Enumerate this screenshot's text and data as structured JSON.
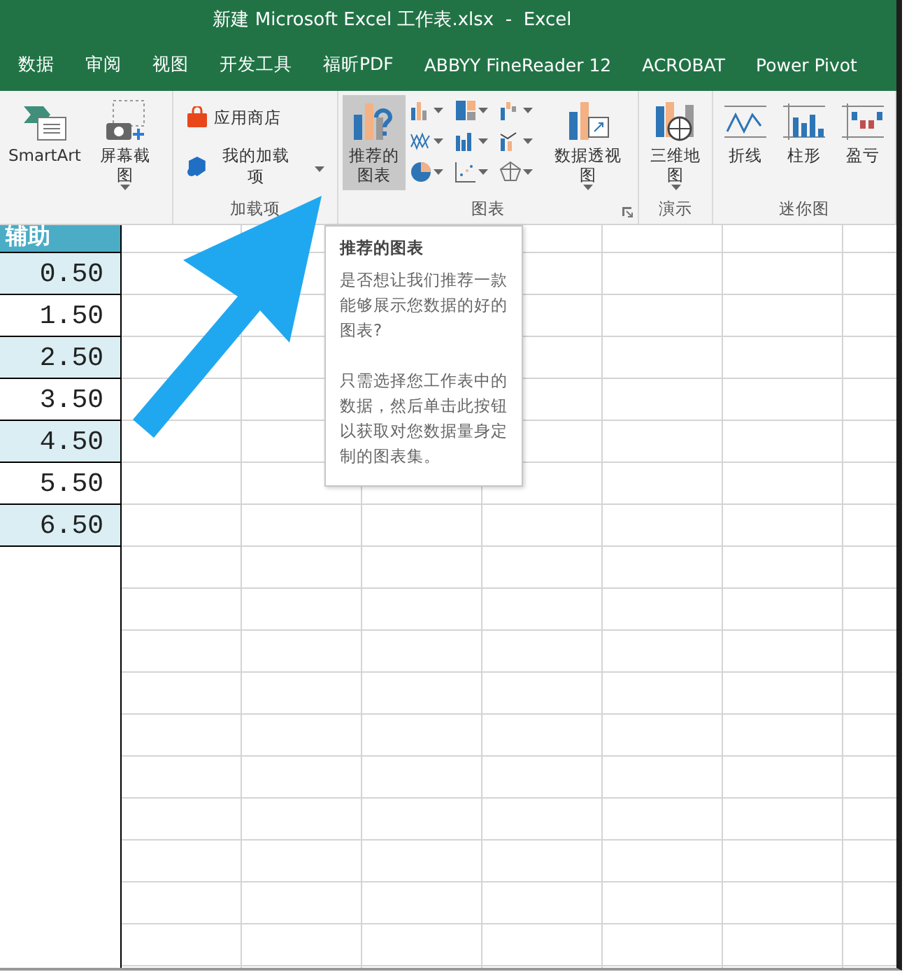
{
  "window": {
    "title": "新建 Microsoft Excel 工作表.xlsx  -  Excel"
  },
  "tabs": [
    "数据",
    "审阅",
    "视图",
    "开发工具",
    "福昕PDF",
    "ABBYY FineReader 12",
    "ACROBAT",
    "Power Pivot"
  ],
  "ribbon": [
    {
      "items": [
        {
          "kind": "smartart",
          "label": "SmartArt",
          "dropdown": false,
          "highlighted": false
        },
        {
          "kind": "screenshot",
          "label": "屏幕截图",
          "dropdown": true,
          "highlighted": false
        }
      ]
    },
    {
      "label": "加载项",
      "items": [
        {
          "kind": "store",
          "label": "应用商店",
          "dropdown": false
        },
        {
          "kind": "addins",
          "label": "我的加载项",
          "dropdown": true
        }
      ]
    },
    {
      "label": "图表",
      "launcher": true,
      "items": [
        {
          "kind": "recommended",
          "label": "推荐的图表",
          "dropdown": false,
          "highlighted": true
        },
        {
          "kind": "chartgrid"
        },
        {
          "kind": "pivotchart",
          "label": "数据透视图",
          "dropdown": true,
          "highlighted": false
        }
      ]
    },
    {
      "label": "演示",
      "items": [
        {
          "kind": "map3d",
          "label": "三维地图",
          "dropdown": true,
          "highlighted": false
        }
      ]
    },
    {
      "label": "迷你图",
      "items": [
        {
          "kind": "spark-line",
          "label": "折线",
          "dropdown": false,
          "highlighted": false
        },
        {
          "kind": "spark-column",
          "label": "柱形",
          "dropdown": false,
          "highlighted": false
        },
        {
          "kind": "spark-winloss",
          "label": "盈亏",
          "dropdown": false,
          "highlighted": false
        }
      ]
    }
  ],
  "column": {
    "header": "辅助",
    "values": [
      "0.50",
      "1.50",
      "2.50",
      "3.50",
      "4.50",
      "5.50",
      "6.50"
    ]
  },
  "tooltip": {
    "title": "推荐的图表",
    "paragraphs": [
      "是否想让我们推荐一款能够展示您数据的好的图表?",
      "只需选择您工作表中的数据，然后单击此按钮以获取对您数据量身定制的图表集。"
    ]
  }
}
